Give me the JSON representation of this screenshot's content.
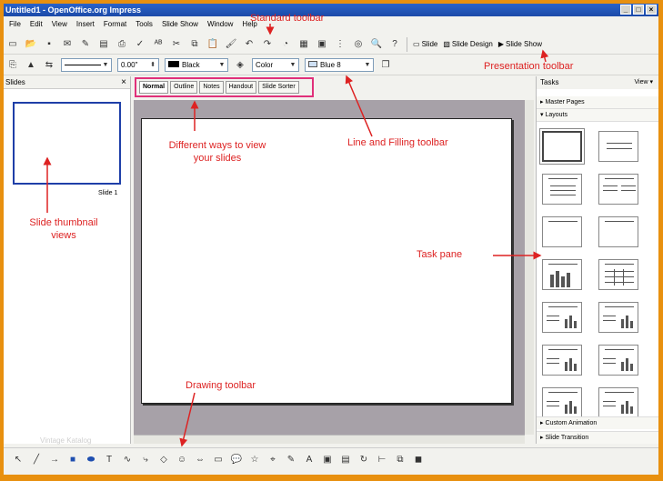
{
  "window": {
    "title": "Untitled1 - OpenOffice.org Impress"
  },
  "menu": [
    "File",
    "Edit",
    "View",
    "Insert",
    "Format",
    "Tools",
    "Slide Show",
    "Window",
    "Help"
  ],
  "standard_toolbar": {
    "buttons": [
      {
        "name": "new-icon",
        "glyph": "▭"
      },
      {
        "name": "open-icon",
        "glyph": "📂"
      },
      {
        "name": "save-icon",
        "glyph": "▪"
      },
      {
        "name": "email-icon",
        "glyph": "✉"
      },
      {
        "name": "edit-file-icon",
        "glyph": "✎"
      },
      {
        "name": "export-pdf-icon",
        "glyph": "▤"
      },
      {
        "name": "print-icon",
        "glyph": "⎙"
      },
      {
        "name": "spellcheck-icon",
        "glyph": "✓"
      },
      {
        "name": "autospell-icon",
        "glyph": "ᴬᴮ"
      },
      {
        "name": "cut-icon",
        "glyph": "✂"
      },
      {
        "name": "copy-icon",
        "glyph": "⧉"
      },
      {
        "name": "paste-icon",
        "glyph": "📋"
      },
      {
        "name": "format-paintbrush-icon",
        "glyph": "🖌"
      },
      {
        "name": "undo-icon",
        "glyph": "↶"
      },
      {
        "name": "redo-icon",
        "glyph": "↷"
      },
      {
        "name": "chart-icon",
        "glyph": "◔"
      },
      {
        "name": "table-icon",
        "glyph": "▦"
      },
      {
        "name": "image-icon",
        "glyph": "▣"
      },
      {
        "name": "grid-icon",
        "glyph": "⋮"
      },
      {
        "name": "navigator-icon",
        "glyph": "◎"
      },
      {
        "name": "zoom-icon",
        "glyph": "🔍"
      },
      {
        "name": "help-icon",
        "glyph": "?"
      }
    ],
    "slide_label": "Slide",
    "slide_design_label": "Slide Design",
    "slide_show_label": "Slide Show"
  },
  "line_fill_toolbar": {
    "line_width": "0.00\"",
    "line_color": "Black",
    "area_style": "Color",
    "fill_color": "Blue 8"
  },
  "view_tabs": [
    "Normal",
    "Outline",
    "Notes",
    "Handout",
    "Slide Sorter"
  ],
  "slides_pane": {
    "title": "Slides",
    "close": "×",
    "thumb_label": "Slide 1"
  },
  "tasks_pane": {
    "title": "Tasks",
    "view_label": "View",
    "sections": {
      "master_pages": "Master Pages",
      "layouts": "Layouts",
      "custom_animation": "Custom Animation",
      "slide_transition": "Slide Transition"
    }
  },
  "annotations": {
    "standard": "Standard toolbar",
    "presentation": "Presentation toolbar",
    "views": "Different ways to view your slides",
    "line_fill": "Line and Filling toolbar",
    "task_pane": "Task pane",
    "thumbnail": "Slide thumbnail views",
    "drawing": "Drawing toolbar"
  },
  "watermark": "Vintage Katalog",
  "colors": {
    "annotation": "#d22222",
    "tab_highlight": "#e0307a",
    "frame": "#e8900f",
    "thumb_border": "#1f3fa8"
  }
}
